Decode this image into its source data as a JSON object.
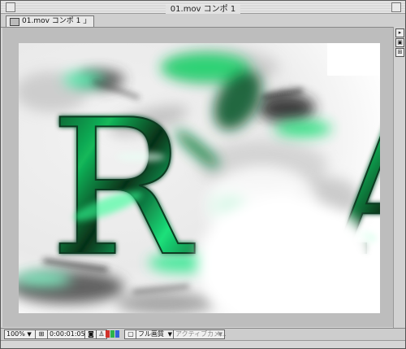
{
  "window": {
    "title": "01.mov コンポ 1"
  },
  "tab": {
    "label": "01.mov コンポ 1",
    "lock": "⅃"
  },
  "side": {
    "arrow": "▸",
    "btn2": "▣",
    "btn3": "⊞"
  },
  "canvas": {
    "letter1": "R",
    "letter2": "A"
  },
  "bottombar": {
    "zoom": "100%",
    "zoom_arrow": "▼",
    "timecode": "0:00:01:05",
    "resolution": "フル画質",
    "resolution_arrow": "▼",
    "camera": "アクティブカメ...",
    "camera_arrow": "▼"
  },
  "colors": {
    "glow": "#29f07a",
    "dark_green": "#0a3a20",
    "accent_red": "#d2322b",
    "accent_green": "#2db34a",
    "accent_blue": "#3560d8"
  }
}
